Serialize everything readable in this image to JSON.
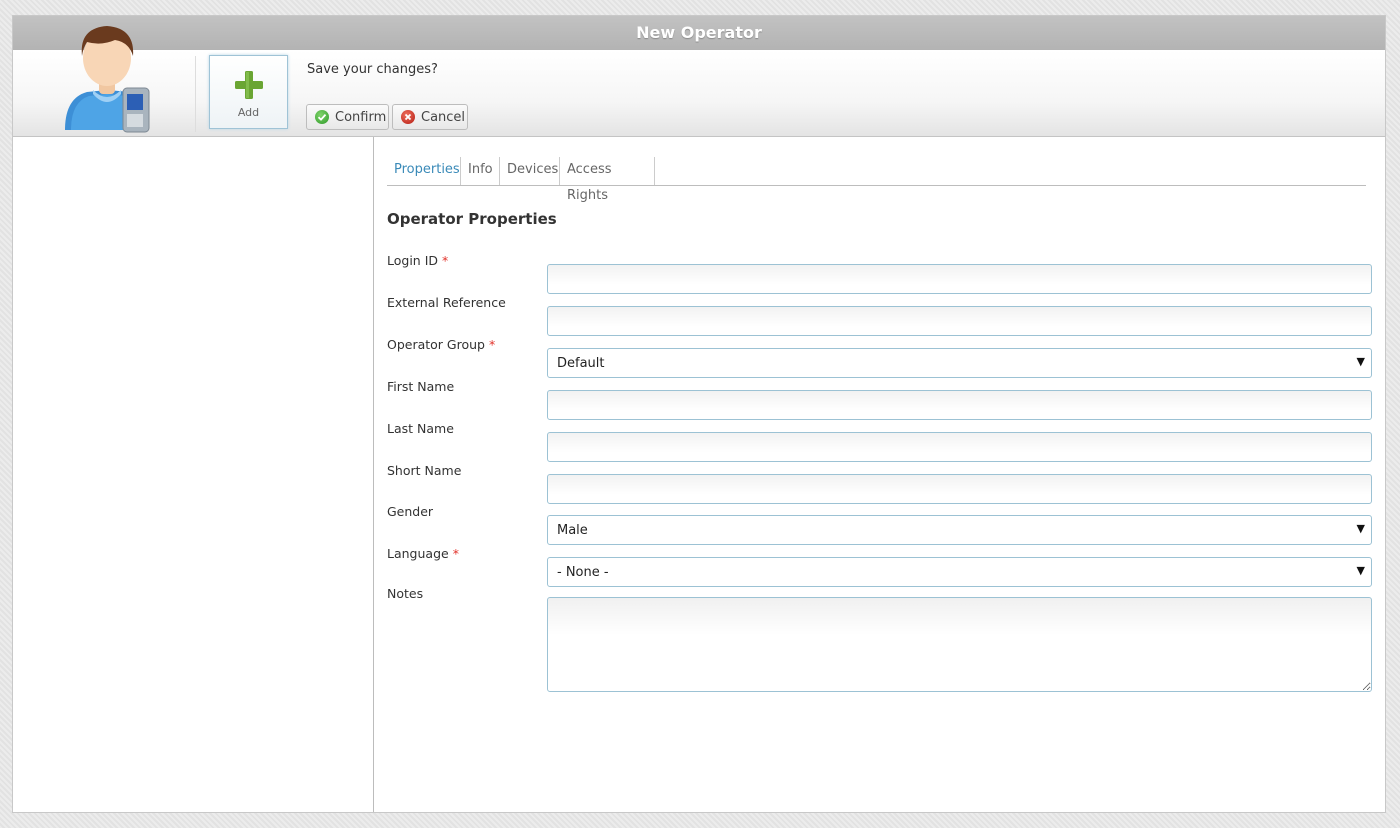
{
  "window": {
    "title": "New Operator"
  },
  "toolbar": {
    "add_label": "Add",
    "save_prompt": "Save your changes?",
    "confirm_label": "Confirm",
    "cancel_label": "Cancel"
  },
  "tabs": [
    {
      "label": "Properties",
      "active": true
    },
    {
      "label": "Info",
      "active": false
    },
    {
      "label": "Devices",
      "active": false
    },
    {
      "label": "Access Rights",
      "active": false
    }
  ],
  "form": {
    "section_title": "Operator Properties",
    "required_marker": "*",
    "fields": {
      "login_id": {
        "label": "Login ID",
        "required": true,
        "value": ""
      },
      "external_reference": {
        "label": "External Reference",
        "required": false,
        "value": ""
      },
      "operator_group": {
        "label": "Operator Group",
        "required": true,
        "value": "Default"
      },
      "first_name": {
        "label": "First Name",
        "required": false,
        "value": ""
      },
      "last_name": {
        "label": "Last Name",
        "required": false,
        "value": ""
      },
      "short_name": {
        "label": "Short Name",
        "required": false,
        "value": ""
      },
      "gender": {
        "label": "Gender",
        "required": false,
        "value": "Male"
      },
      "language": {
        "label": "Language",
        "required": true,
        "value": "- None -"
      },
      "notes": {
        "label": "Notes",
        "required": false,
        "value": ""
      }
    }
  },
  "icons": {
    "avatar": "operator-avatar-icon",
    "add": "plus-icon",
    "confirm": "check-circle-icon",
    "cancel": "x-circle-icon",
    "dropdown": "triangle-down-icon"
  },
  "colors": {
    "titlebar": "#b8b8b8",
    "active_tab": "#3a8ab8",
    "required": "#e2322a",
    "field_border": "#9cc2d4",
    "confirm_green": "#2f9a2a",
    "cancel_red": "#b31b12"
  }
}
